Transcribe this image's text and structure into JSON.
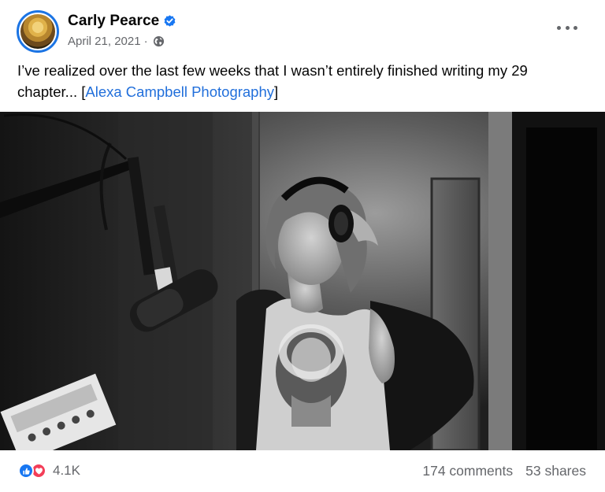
{
  "post": {
    "author": "Carly Pearce",
    "verified_icon": "verified-badge-icon",
    "date": "April 21, 2021",
    "separator": "·",
    "audience_icon": "globe-icon",
    "more_icon": "more-options-icon",
    "text_line_1": "I’ve realized over the last few weeks that I wasn’t entirely finished writing my 29",
    "text_line_2_prefix": "chapter... [",
    "photo_credit": "Alexa Campbell Photography",
    "text_line_2_suffix": "]",
    "image_alt": "Black and white photo of a woman wearing headphones in a recording studio in front of a microphone"
  },
  "reactions": {
    "icons": [
      "like-icon",
      "love-icon"
    ],
    "count": "4.1K"
  },
  "stats": {
    "comments": "174 comments",
    "shares": "53 shares"
  },
  "colors": {
    "brand_blue": "#1877f2",
    "link_blue": "#216fdb",
    "love_red": "#f33e58",
    "secondary_text": "#65676b"
  }
}
